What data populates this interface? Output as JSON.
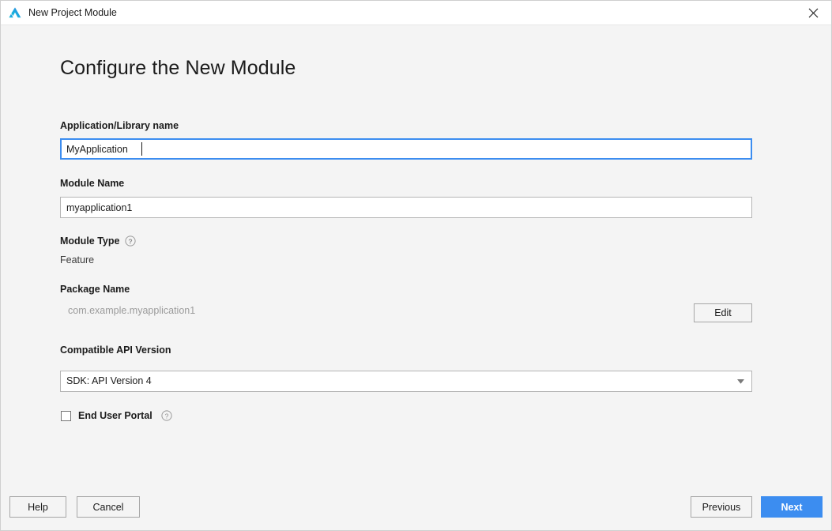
{
  "window": {
    "title": "New Project Module",
    "logo_icon": "deveco-triangle-logo",
    "close_icon": "close-icon"
  },
  "page": {
    "heading": "Configure the New Module"
  },
  "fields": {
    "app_name": {
      "label": "Application/Library name",
      "value": "MyApplication",
      "placeholder": "",
      "focused": true
    },
    "module_name": {
      "label": "Module Name",
      "value": "myapplication1",
      "placeholder": ""
    },
    "module_type": {
      "label": "Module Type",
      "help_icon": "question-mark-icon",
      "value": "Feature"
    },
    "package_name": {
      "label": "Package Name",
      "value": "com.example.myapplication1",
      "edit_label": "Edit"
    },
    "api_version": {
      "label": "Compatible API Version",
      "value": "SDK: API Version 4",
      "dropdown_icon": "chevron-down-icon",
      "options": [
        "SDK: API Version 4"
      ]
    },
    "end_user_portal": {
      "label": "End User Portal",
      "checked": false,
      "help_icon": "question-mark-icon"
    }
  },
  "footer": {
    "help_label": "Help",
    "cancel_label": "Cancel",
    "previous_label": "Previous",
    "next_label": "Next"
  },
  "colors": {
    "accent": "#3c8df0",
    "background": "#f4f4f4",
    "titlebar": "#ffffff",
    "input_border": "#b5b5b5",
    "muted_text": "#9b9b9b"
  }
}
